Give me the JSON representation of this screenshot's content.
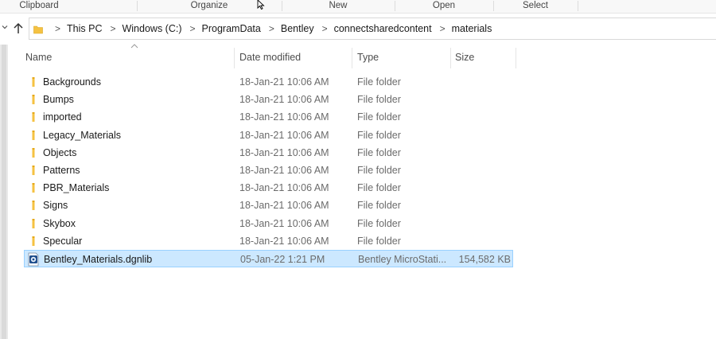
{
  "ribbon": {
    "groups": [
      "Clipboard",
      "Organize",
      "New",
      "Open",
      "Select"
    ]
  },
  "address": {
    "crumbs": [
      "This PC",
      "Windows (C:)",
      "ProgramData",
      "Bentley",
      "connectsharedcontent",
      "materials"
    ]
  },
  "columns": {
    "name": "Name",
    "date": "Date modified",
    "type": "Type",
    "size": "Size"
  },
  "rows": [
    {
      "name": "Backgrounds",
      "date": "18-Jan-21 10:06 AM",
      "type": "File folder",
      "size": "",
      "icon": "folder-icon"
    },
    {
      "name": "Bumps",
      "date": "18-Jan-21 10:06 AM",
      "type": "File folder",
      "size": "",
      "icon": "folder-icon"
    },
    {
      "name": "imported",
      "date": "18-Jan-21 10:06 AM",
      "type": "File folder",
      "size": "",
      "icon": "folder-icon"
    },
    {
      "name": "Legacy_Materials",
      "date": "18-Jan-21 10:06 AM",
      "type": "File folder",
      "size": "",
      "icon": "folder-icon"
    },
    {
      "name": "Objects",
      "date": "18-Jan-21 10:06 AM",
      "type": "File folder",
      "size": "",
      "icon": "folder-icon"
    },
    {
      "name": "Patterns",
      "date": "18-Jan-21 10:06 AM",
      "type": "File folder",
      "size": "",
      "icon": "folder-icon"
    },
    {
      "name": "PBR_Materials",
      "date": "18-Jan-21 10:06 AM",
      "type": "File folder",
      "size": "",
      "icon": "folder-icon"
    },
    {
      "name": "Signs",
      "date": "18-Jan-21 10:06 AM",
      "type": "File folder",
      "size": "",
      "icon": "folder-icon"
    },
    {
      "name": "Skybox",
      "date": "18-Jan-21 10:06 AM",
      "type": "File folder",
      "size": "",
      "icon": "folder-icon"
    },
    {
      "name": "Specular",
      "date": "18-Jan-21 10:06 AM",
      "type": "File folder",
      "size": "",
      "icon": "folder-icon"
    },
    {
      "name": "Bentley_Materials.dgnlib",
      "date": "05-Jan-22 1:21 PM",
      "type": "Bentley MicroStati...",
      "size": "154,582 KB",
      "icon": "dgnlib-file-icon",
      "selected": true
    }
  ],
  "colors": {
    "selection_bg": "#cce8ff",
    "selection_border": "#99d1ff",
    "folder_yellow": "#f5c242"
  }
}
